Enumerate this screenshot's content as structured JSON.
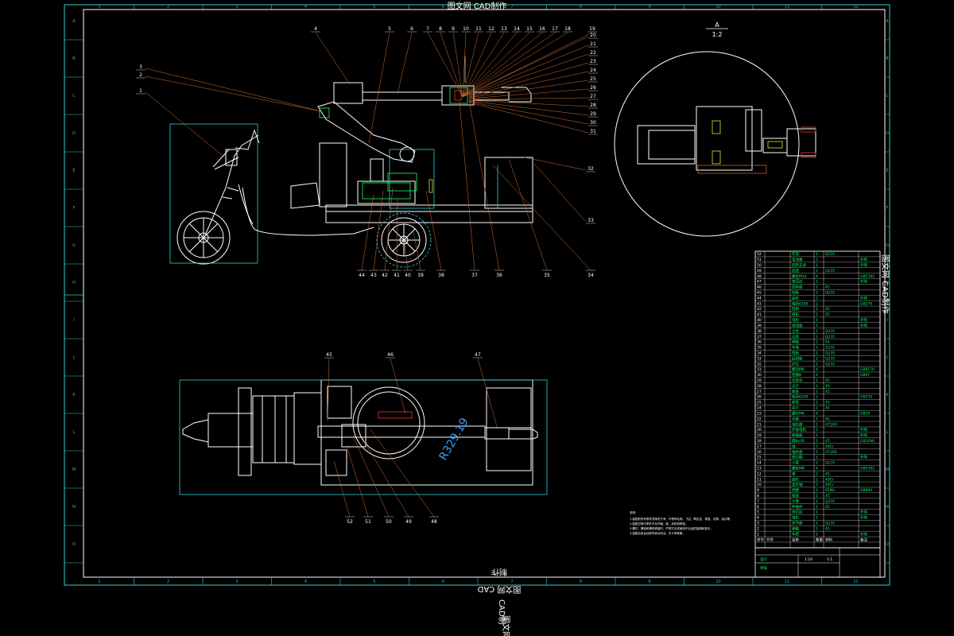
{
  "header": {
    "title": "图文网 CAD制作"
  },
  "zones": {
    "columns": [
      "1",
      "2",
      "3",
      "4",
      "5",
      "6",
      "7",
      "8",
      "9",
      "10",
      "11",
      "12"
    ],
    "rows": [
      "A",
      "B",
      "C",
      "D",
      "E",
      "F",
      "G",
      "H",
      "I",
      "J",
      "K",
      "L",
      "M",
      "N",
      "O"
    ]
  },
  "side_view": {
    "top_labels": [
      "4",
      "5",
      "6",
      "7",
      "8",
      "9",
      "10",
      "11",
      "12",
      "13",
      "14",
      "15",
      "16",
      "17",
      "18",
      "19"
    ],
    "right_labels": [
      "20",
      "21",
      "22",
      "23",
      "24",
      "25",
      "26",
      "27",
      "28",
      "29",
      "30",
      "31"
    ],
    "left_labels": [
      "3",
      "2",
      "1"
    ],
    "bottom_labels": [
      "44",
      "43",
      "42",
      "41",
      "40",
      "39",
      "38",
      "37",
      "36",
      "35",
      "34"
    ],
    "far_right_labels": [
      "32",
      "33"
    ]
  },
  "top_view": {
    "top_labels": [
      "45",
      "46",
      "47"
    ],
    "bottom_labels": [
      "52",
      "51",
      "50",
      "49",
      "48"
    ],
    "callout": "R329.19"
  },
  "detail": {
    "title": "A",
    "scale": "1:2"
  },
  "notes": {
    "heading": "说明:",
    "lines": [
      "1.装配前所有零件须清洗干净，不得有毛刺、飞边、氧化皮、锈蚀、切屑、油污等。",
      "2.装配过程中零件不允许磕、碰、划伤和锈蚀。",
      "3.螺钉、螺栓和螺母紧固时，严禁打击或使用不合适的旋具和扳手。",
      "4.装配后各运动部件转动灵活，无卡滞现象。"
    ]
  },
  "bom": {
    "side_text": "图文网 CAD制作",
    "header": [
      "序号",
      "代号",
      "名称",
      "数量",
      "材料",
      "备注"
    ],
    "rows": [
      [
        "52",
        "",
        "车架",
        "1",
        "Q235",
        ""
      ],
      [
        "51",
        "",
        "电池箱",
        "1",
        "",
        "外购"
      ],
      [
        "50",
        "",
        "回转支承",
        "1",
        "",
        "外购"
      ],
      [
        "49",
        "",
        "底座",
        "1",
        "Q235",
        ""
      ],
      [
        "48",
        "",
        "螺栓M10",
        "8",
        "",
        "GB5782"
      ],
      [
        "47",
        "",
        "液压缸",
        "1",
        "",
        "外购"
      ],
      [
        "46",
        "",
        "回转盘",
        "1",
        "45",
        ""
      ],
      [
        "45",
        "",
        "挡板",
        "2",
        "Q235",
        ""
      ],
      [
        "44",
        "",
        "后轮",
        "2",
        "",
        "外购"
      ],
      [
        "43",
        "",
        "轴承6206",
        "2",
        "",
        "GB276"
      ],
      [
        "42",
        "",
        "后桥",
        "1",
        "45",
        ""
      ],
      [
        "41",
        "",
        "链轮",
        "1",
        "45",
        ""
      ],
      [
        "40",
        "",
        "电机",
        "1",
        "",
        "外购"
      ],
      [
        "39",
        "",
        "减速器",
        "1",
        "",
        "外购"
      ],
      [
        "38",
        "",
        "立柱",
        "1",
        "Q235",
        ""
      ],
      [
        "37",
        "",
        "支座",
        "1",
        "Q235",
        ""
      ],
      [
        "36",
        "",
        "销轴",
        "2",
        "45",
        ""
      ],
      [
        "35",
        "",
        "车厢",
        "1",
        "Q235",
        ""
      ],
      [
        "34",
        "",
        "挡板",
        "1",
        "Q235",
        ""
      ],
      [
        "33",
        "",
        "后挡板",
        "1",
        "Q235",
        ""
      ],
      [
        "32",
        "",
        "护栏",
        "1",
        "Q235",
        ""
      ],
      [
        "31",
        "",
        "螺母M8",
        "4",
        "",
        "GB6170"
      ],
      [
        "30",
        "",
        "垫圈8",
        "4",
        "",
        "GB97"
      ],
      [
        "29",
        "",
        "连接块",
        "1",
        "45",
        ""
      ],
      [
        "28",
        "",
        "法兰",
        "1",
        "45",
        ""
      ],
      [
        "27",
        "",
        "端盖",
        "1",
        "45",
        ""
      ],
      [
        "26",
        "",
        "轴承6204",
        "2",
        "",
        "GB276"
      ],
      [
        "25",
        "",
        "套筒",
        "1",
        "45",
        ""
      ],
      [
        "24",
        "",
        "夹爪",
        "2",
        "45",
        ""
      ],
      [
        "23",
        "",
        "螺钉M6",
        "6",
        "",
        "GB70"
      ],
      [
        "22",
        "",
        "手腕",
        "1",
        "45",
        ""
      ],
      [
        "21",
        "",
        "电机座",
        "1",
        "HT200",
        ""
      ],
      [
        "20",
        "",
        "步进电机",
        "1",
        "",
        "外购"
      ],
      [
        "19",
        "",
        "联轴器",
        "1",
        "",
        "外购"
      ],
      [
        "18",
        "",
        "键8x30",
        "1",
        "45",
        "GB1096"
      ],
      [
        "17",
        "",
        "轴",
        "1",
        "40Cr",
        ""
      ],
      [
        "16",
        "",
        "轴承座",
        "1",
        "HT200",
        ""
      ],
      [
        "15",
        "",
        "密封圈",
        "1",
        "",
        "外购"
      ],
      [
        "14",
        "",
        "小臂",
        "1",
        "Q235",
        ""
      ],
      [
        "13",
        "",
        "螺栓M8",
        "4",
        "",
        "GB5782"
      ],
      [
        "12",
        "",
        "销",
        "2",
        "45",
        ""
      ],
      [
        "11",
        "",
        "齿轮",
        "1",
        "40Cr",
        ""
      ],
      [
        "10",
        "",
        "齿轮轴",
        "1",
        "40Cr",
        ""
      ],
      [
        "9",
        "",
        "挡圈",
        "2",
        "65Mn",
        "GB894"
      ],
      [
        "8",
        "",
        "端盖",
        "1",
        "45",
        ""
      ],
      [
        "7",
        "",
        "大臂",
        "1",
        "Q235",
        ""
      ],
      [
        "6",
        "",
        "伸缩杆",
        "1",
        "45",
        ""
      ],
      [
        "5",
        "",
        "液压缸",
        "1",
        "",
        "外购"
      ],
      [
        "4",
        "",
        "电机",
        "1",
        "",
        "外购"
      ],
      [
        "3",
        "",
        "关节座",
        "1",
        "Q235",
        ""
      ],
      [
        "2",
        "",
        "销轴",
        "1",
        "45",
        ""
      ],
      [
        "1",
        "",
        "车把",
        "1",
        "",
        "外购"
      ]
    ]
  },
  "title_block": {
    "drawn": "设计",
    "checked": "审核",
    "scale": "1:10",
    "sheet": "1:1"
  },
  "bottom_watermark": {
    "line1": "制作",
    "line2": "图文网 CAD",
    "line3": "CAD制",
    "line4": "图文网 CAD"
  },
  "colors": {
    "frame": "#30d0d0",
    "outline": "#ffffff",
    "leader": "#d87030",
    "part_green": "#20ff60",
    "bom_text": "#00ff66",
    "callout": "#30a0ff"
  }
}
